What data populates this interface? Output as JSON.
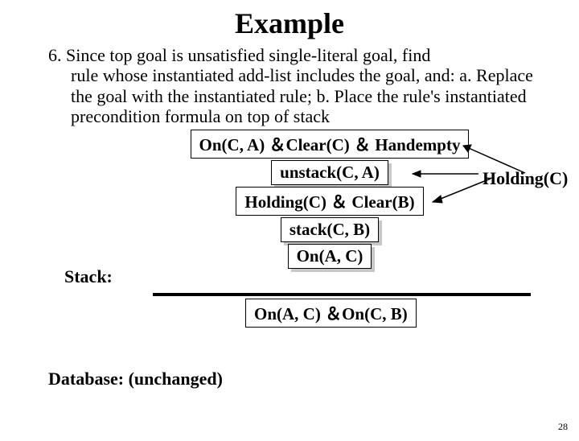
{
  "title": "Example",
  "step_number": "6.",
  "step_text_line1": "Since top goal is unsatisfied single-literal goal, find",
  "step_text_rest": "rule whose instantiated add-list includes the goal, and:  a. Replace the goal with the instantiated rule; b. Place the rule's instantiated precondition formula on top of stack",
  "stack_label": "Stack:",
  "boxes": {
    "precond1": "On(C, A) ＆Clear(C) ＆ Handempty",
    "op1": "unstack(C, A)",
    "precond2": "Holding(C) ＆ Clear(B)",
    "op2": "stack(C, B)",
    "sub": "On(A, C)",
    "goal": "On(A, C) ＆On(C, B)"
  },
  "side_label": "Holding(C)",
  "database_label": "Database: (unchanged)",
  "page_number": "28"
}
